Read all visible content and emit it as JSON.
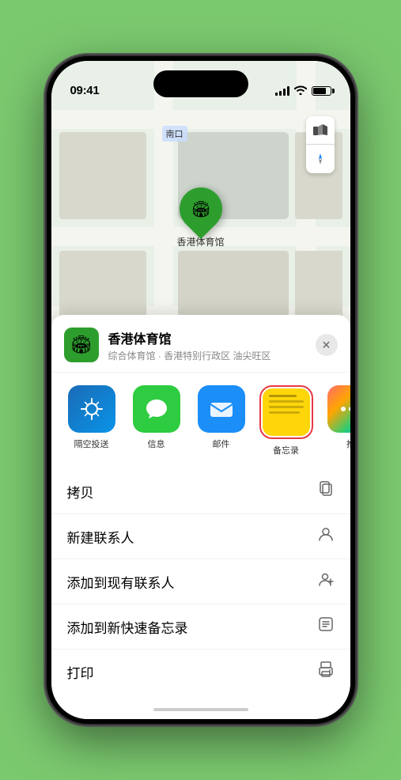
{
  "statusBar": {
    "time": "09:41",
    "locationArrow": "▸"
  },
  "map": {
    "label": "南口"
  },
  "mapControls": {
    "mapIcon": "🗺",
    "compassIcon": "➤"
  },
  "venue": {
    "name": "香港体育馆",
    "address": "综合体育馆 · 香港特别行政区 油尖旺区",
    "pinLabel": "香港体育馆"
  },
  "shareApps": [
    {
      "id": "airdrop",
      "label": "隔空投送"
    },
    {
      "id": "messages",
      "label": "信息"
    },
    {
      "id": "mail",
      "label": "邮件"
    },
    {
      "id": "notes",
      "label": "备忘录"
    },
    {
      "id": "more",
      "label": "推"
    }
  ],
  "actions": [
    {
      "label": "拷贝",
      "icon": "copy"
    },
    {
      "label": "新建联系人",
      "icon": "person"
    },
    {
      "label": "添加到现有联系人",
      "icon": "person-add"
    },
    {
      "label": "添加到新快速备忘录",
      "icon": "note"
    },
    {
      "label": "打印",
      "icon": "print"
    }
  ]
}
